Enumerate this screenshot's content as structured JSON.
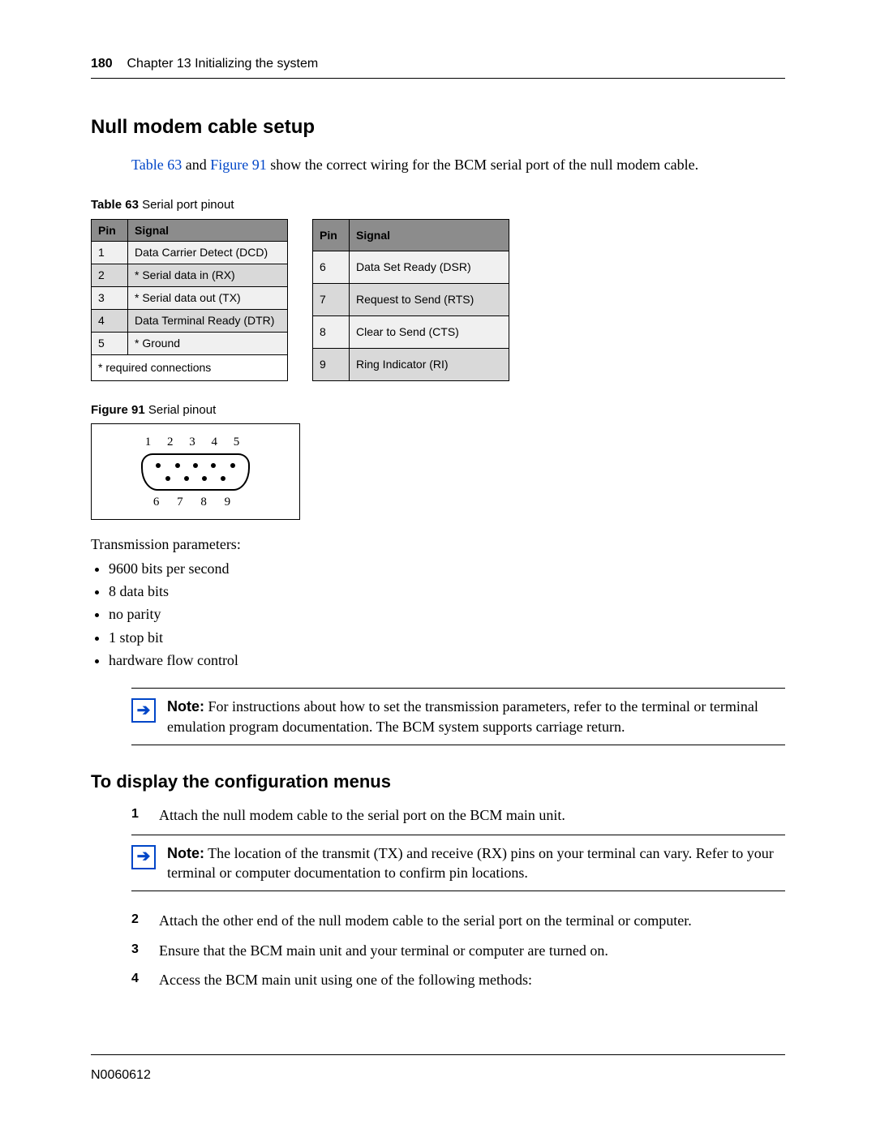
{
  "header": {
    "page_number": "180",
    "chapter": "Chapter 13  Initializing the system"
  },
  "section1_title": "Null modem cable setup",
  "intro_parts": {
    "pre": "",
    "link1": "Table 63",
    "mid": " and ",
    "link2": "Figure 91",
    "post": " show the correct wiring for the BCM serial port of the null modem cable."
  },
  "table_caption": {
    "label": "Table 63",
    "title": "   Serial port pinout"
  },
  "table_headers": {
    "pin": "Pin",
    "signal": "Signal"
  },
  "table_left": [
    {
      "pin": "1",
      "signal": "Data Carrier Detect (DCD)"
    },
    {
      "pin": "2",
      "signal": "* Serial data in (RX)"
    },
    {
      "pin": "3",
      "signal": "* Serial data out (TX)"
    },
    {
      "pin": "4",
      "signal": "Data Terminal Ready (DTR)"
    },
    {
      "pin": "5",
      "signal": "* Ground"
    }
  ],
  "table_right": [
    {
      "pin": "6",
      "signal": "Data Set Ready (DSR)"
    },
    {
      "pin": "7",
      "signal": "Request to Send (RTS)"
    },
    {
      "pin": "8",
      "signal": "Clear to Send (CTS)"
    },
    {
      "pin": "9",
      "signal": "Ring Indicator (RI)"
    }
  ],
  "table_footnote": "* required connections",
  "figure_caption": {
    "label": "Figure 91",
    "title": "   Serial pinout"
  },
  "figure_numbers_top": "1  2  3  4  5",
  "figure_numbers_bottom": "6  7  8  9",
  "trans_params_title": "Transmission parameters:",
  "trans_params": [
    "9600 bits per second",
    "8 data bits",
    "no parity",
    "1 stop bit",
    "hardware flow control"
  ],
  "note1": {
    "label": "Note:",
    "text": " For instructions about how to set the transmission parameters, refer to the terminal or terminal emulation program documentation. The BCM system supports carriage return."
  },
  "section2_title": "To display the configuration menus",
  "steps": [
    "Attach the null modem cable to the serial port on the BCM main unit.",
    "Attach the other end of the null modem cable to the serial port on the terminal or computer.",
    "Ensure that the BCM main unit and your terminal or computer are turned on.",
    "Access the BCM main unit using one of the following methods:"
  ],
  "note2": {
    "label": "Note:",
    "text": " The location of the transmit (TX) and receive (RX) pins on your terminal can vary. Refer to your terminal or computer documentation to confirm pin locations."
  },
  "footer_code": "N0060612"
}
